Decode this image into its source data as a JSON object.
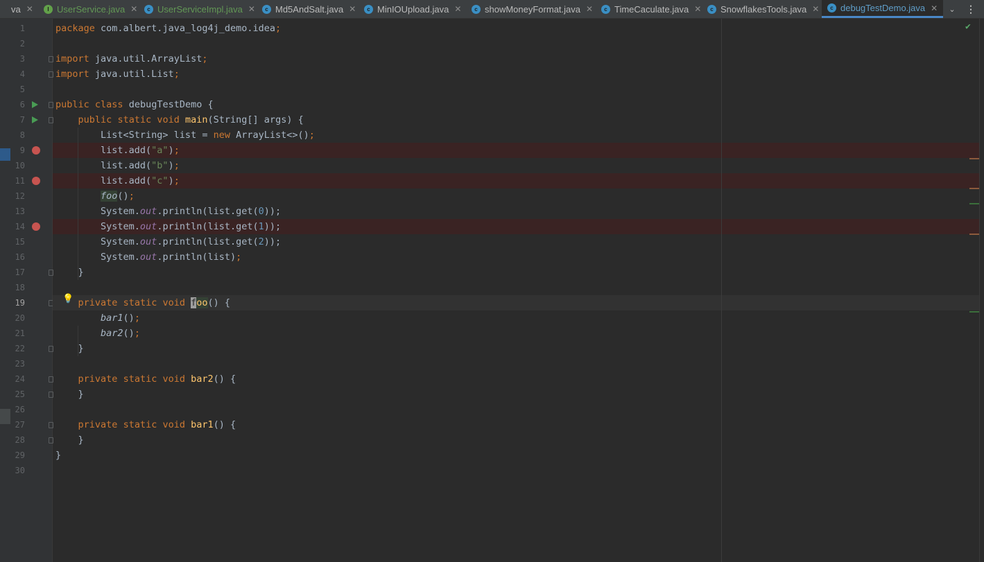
{
  "tabs": [
    {
      "label": "va",
      "icon": "none",
      "state": "partial"
    },
    {
      "label": "UserService.java",
      "icon": "interface-icon",
      "state": "modified"
    },
    {
      "label": "UserServiceImpl.java",
      "icon": "class-icon",
      "state": "modified"
    },
    {
      "label": "Md5AndSalt.java",
      "icon": "class-icon",
      "state": "normal"
    },
    {
      "label": "MinIOUpload.java",
      "icon": "class-icon",
      "state": "normal"
    },
    {
      "label": "showMoneyFormat.java",
      "icon": "class-icon",
      "state": "normal"
    },
    {
      "label": "TimeCaculate.java",
      "icon": "class-icon",
      "state": "normal"
    },
    {
      "label": "SnowflakesTools.java",
      "icon": "class-icon",
      "state": "normal"
    },
    {
      "label": "debugTestDemo.java",
      "icon": "class-icon",
      "state": "active"
    }
  ],
  "tab_close_glyph": "✕",
  "tab_icon_letters": {
    "class": "c",
    "interface": "I"
  },
  "overflow_glyph": "⌄",
  "menu_glyph": "⋮",
  "inspection_ok_glyph": "✔",
  "lightbulb_glyph": "💡",
  "current_line": 19,
  "breakpoint_lines": [
    9,
    11,
    14
  ],
  "run_lines": [
    6,
    7
  ],
  "colors": {
    "keyword": "#cc7832",
    "string": "#6a8759",
    "number": "#6897bb",
    "method_decl": "#ffc66d",
    "static_field": "#9876aa",
    "breakpoint": "#c75450",
    "run": "#499c54",
    "active_tab_underline": "#4a88c7"
  },
  "code_lines": [
    "package com.albert.java_log4j_demo.idea;",
    "",
    "import java.util.ArrayList;",
    "import java.util.List;",
    "",
    "public class debugTestDemo {",
    "    public static void main(String[] args) {",
    "        List<String> list = new ArrayList<>();",
    "        list.add(\"a\");",
    "        list.add(\"b\");",
    "        list.add(\"c\");",
    "        foo();",
    "        System.out.println(list.get(0));",
    "        System.out.println(list.get(1));",
    "        System.out.println(list.get(2));",
    "        System.out.println(list);",
    "    }",
    "",
    "    private static void foo() {",
    "        bar1();",
    "        bar2();",
    "    }",
    "",
    "    private static void bar2() {",
    "    }",
    "",
    "    private static void bar1() {",
    "    }",
    "}",
    ""
  ]
}
